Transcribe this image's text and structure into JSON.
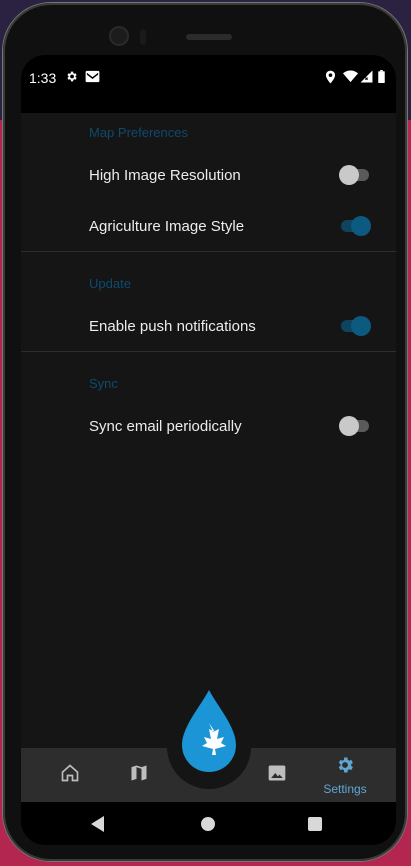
{
  "status": {
    "time": "1:33"
  },
  "settings": {
    "sections": [
      {
        "title": "Map Preferences",
        "rows": [
          {
            "label": "High Image Resolution",
            "enabled": false
          },
          {
            "label": "Agriculture Image Style",
            "enabled": true
          }
        ]
      },
      {
        "title": "Update",
        "rows": [
          {
            "label": "Enable push notifications",
            "enabled": true
          }
        ]
      },
      {
        "title": "Sync",
        "rows": [
          {
            "label": "Sync email periodically",
            "enabled": false
          }
        ]
      }
    ]
  },
  "bottom_nav": {
    "items": [
      {
        "icon": "home-icon"
      },
      {
        "icon": "map-icon"
      },
      {
        "icon": "image-icon"
      },
      {
        "icon": "gear-icon",
        "label": "Settings"
      }
    ]
  },
  "colors": {
    "accent": "#5ea7d3",
    "section_title": "#0f4a6d",
    "switch_on": "#0c5a80",
    "background": "#151515"
  }
}
